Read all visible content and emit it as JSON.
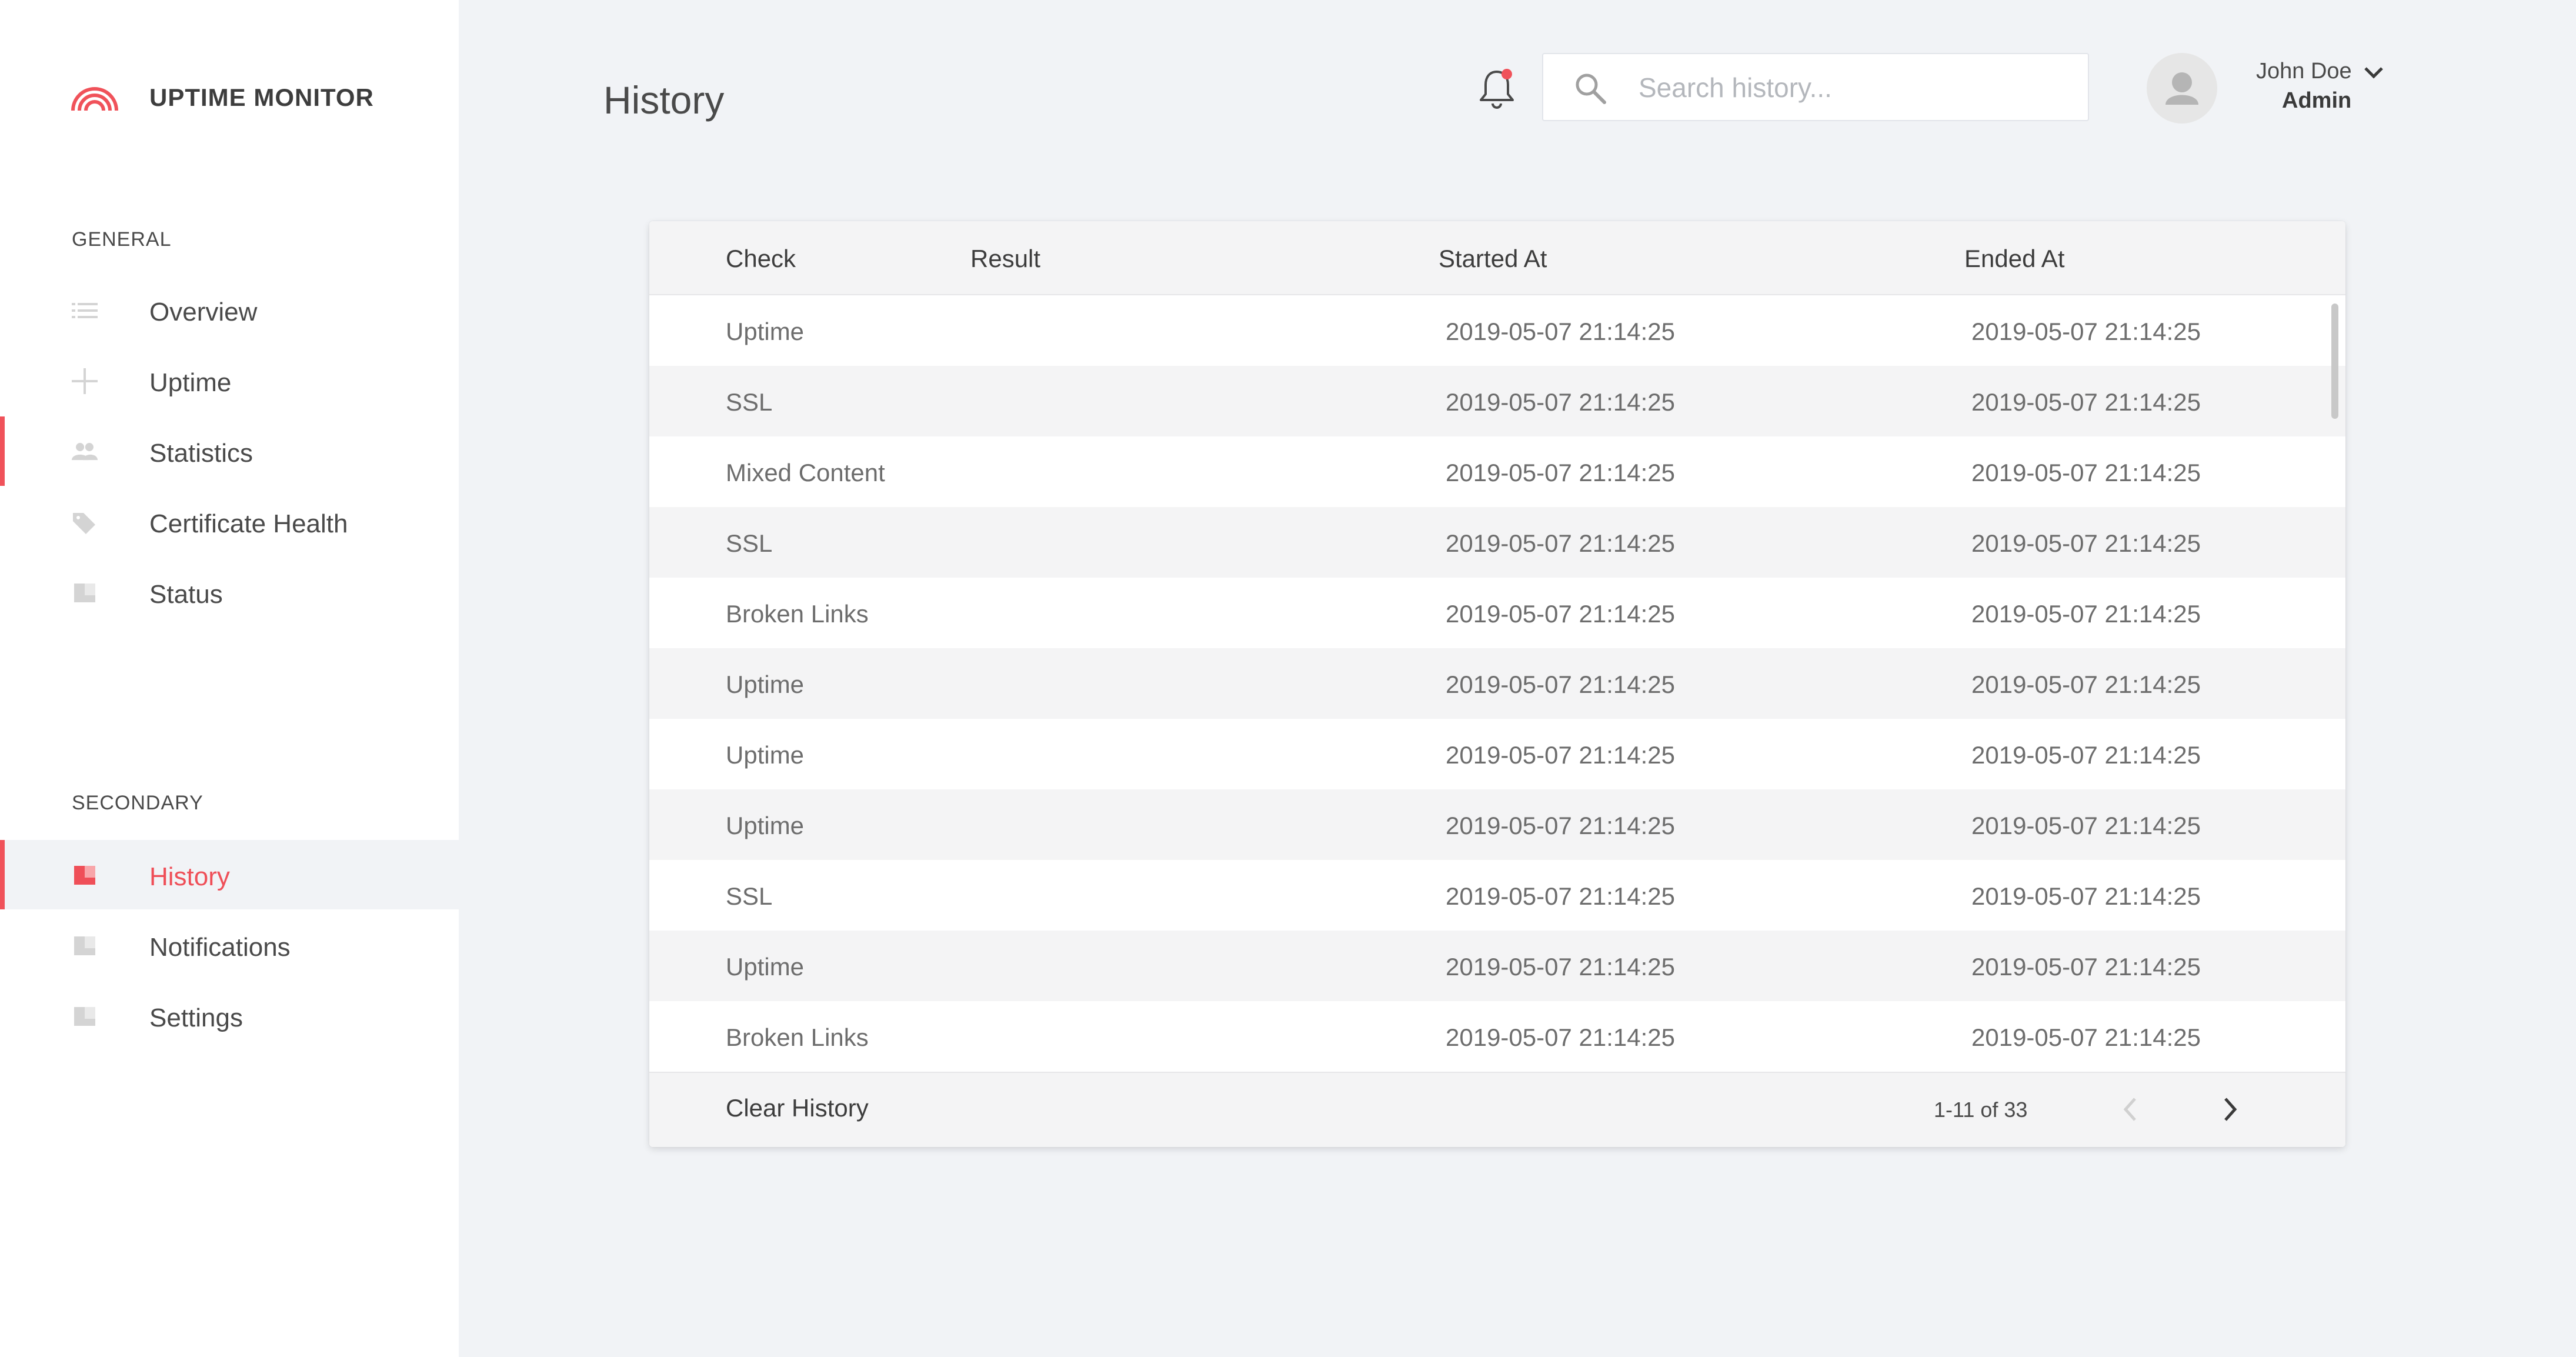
{
  "app": {
    "name": "UPTIME MONITOR"
  },
  "sidebar": {
    "general_label": "GENERAL",
    "secondary_label": "SECONDARY",
    "general_items": [
      {
        "label": "Overview",
        "icon": "list-icon"
      },
      {
        "label": "Uptime",
        "icon": "plus-icon"
      },
      {
        "label": "Statistics",
        "icon": "users-icon"
      },
      {
        "label": "Certificate Health",
        "icon": "tag-icon"
      },
      {
        "label": "Status",
        "icon": "book-icon"
      }
    ],
    "secondary_items": [
      {
        "label": "History",
        "icon": "book-icon",
        "active": true
      },
      {
        "label": "Notifications",
        "icon": "book-icon"
      },
      {
        "label": "Settings",
        "icon": "book-icon"
      }
    ]
  },
  "header": {
    "title": "History",
    "search_placeholder": "Search history...",
    "user": {
      "name": "John Doe",
      "role": "Admin"
    }
  },
  "table": {
    "columns": {
      "check": "Check",
      "result": "Result",
      "started": "Started At",
      "ended": "Ended At"
    },
    "rows": [
      {
        "check": "Uptime",
        "result": "",
        "started": "2019-05-07 21:14:25",
        "ended": "2019-05-07 21:14:25"
      },
      {
        "check": "SSL",
        "result": "",
        "started": "2019-05-07 21:14:25",
        "ended": "2019-05-07 21:14:25"
      },
      {
        "check": "Mixed Content",
        "result": "",
        "started": "2019-05-07 21:14:25",
        "ended": "2019-05-07 21:14:25"
      },
      {
        "check": "SSL",
        "result": "",
        "started": "2019-05-07 21:14:25",
        "ended": "2019-05-07 21:14:25"
      },
      {
        "check": "Broken Links",
        "result": "",
        "started": "2019-05-07 21:14:25",
        "ended": "2019-05-07 21:14:25"
      },
      {
        "check": "Uptime",
        "result": "",
        "started": "2019-05-07 21:14:25",
        "ended": "2019-05-07 21:14:25"
      },
      {
        "check": "Uptime",
        "result": "",
        "started": "2019-05-07 21:14:25",
        "ended": "2019-05-07 21:14:25"
      },
      {
        "check": "Uptime",
        "result": "",
        "started": "2019-05-07 21:14:25",
        "ended": "2019-05-07 21:14:25"
      },
      {
        "check": "SSL",
        "result": "",
        "started": "2019-05-07 21:14:25",
        "ended": "2019-05-07 21:14:25"
      },
      {
        "check": "Uptime",
        "result": "",
        "started": "2019-05-07 21:14:25",
        "ended": "2019-05-07 21:14:25"
      },
      {
        "check": "Broken Links",
        "result": "",
        "started": "2019-05-07 21:14:25",
        "ended": "2019-05-07 21:14:25"
      }
    ],
    "footer": {
      "clear_label": "Clear History",
      "page_info": "1-11 of 33"
    }
  },
  "colors": {
    "accent": "#f0525a",
    "background": "#f1f3f6",
    "sidebar": "#ffffff"
  }
}
